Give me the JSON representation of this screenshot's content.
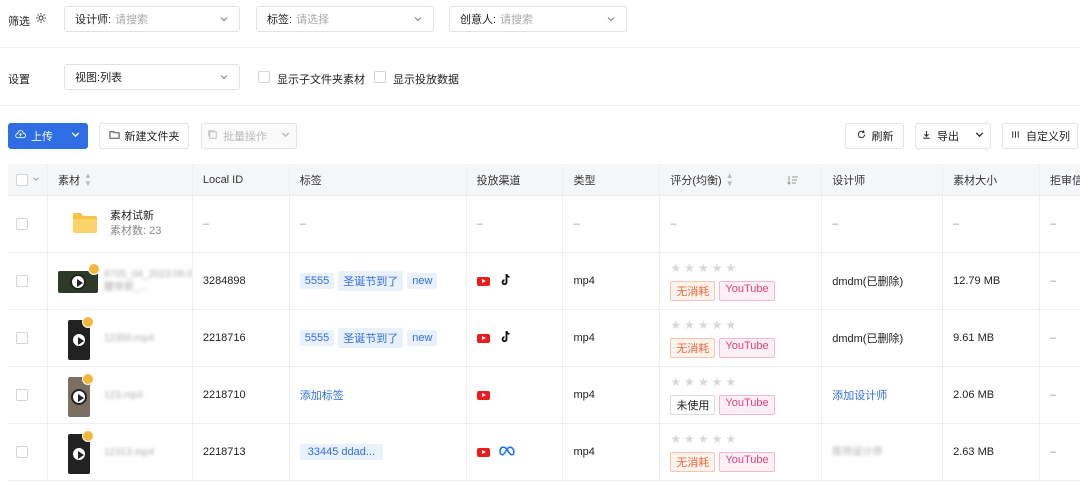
{
  "filter": {
    "label": "筛选",
    "designer": {
      "key": "设计师:",
      "placeholder": "请搜索"
    },
    "tags": {
      "key": "标签:",
      "placeholder": "请选择"
    },
    "creator": {
      "key": "创意人:",
      "placeholder": "请搜索"
    }
  },
  "settings": {
    "label": "设置",
    "view": {
      "key": "视图:",
      "value": "列表"
    },
    "show_subfolder": "显示子文件夹素材",
    "show_delivery": "显示投放数据"
  },
  "toolbar": {
    "upload": "上传",
    "new_folder": "新建文件夹",
    "batch": "批量操作",
    "refresh": "刷新",
    "export": "导出",
    "custom_columns": "自定义列"
  },
  "table": {
    "headers": [
      "素材",
      "Local ID",
      "标签",
      "投放渠道",
      "类型",
      "评分(均衡)",
      "设计师",
      "素材大小",
      "拒审信"
    ],
    "folder_row": {
      "name": "素材试新",
      "count": "素材数: 23",
      "dash": "–"
    },
    "rows": [
      {
        "filename": "8705_04_2023.06.02_腰背新_...",
        "local_id": "3284898",
        "tags": [
          "5555",
          "圣诞节到了",
          "new"
        ],
        "channels": [
          "youtube",
          "tiktok"
        ],
        "type": "mp4",
        "status": "无消耗",
        "channel_pill": "YouTube",
        "designer": "dmdm(已删除)",
        "size": "12.79 MB",
        "reject": "–"
      },
      {
        "filename": "12350.mp4",
        "local_id": "2218716",
        "tags": [
          "5555",
          "圣诞节到了",
          "new"
        ],
        "channels": [
          "youtube",
          "tiktok"
        ],
        "type": "mp4",
        "status": "无消耗",
        "channel_pill": "YouTube",
        "designer": "dmdm(已删除)",
        "size": "9.61 MB",
        "reject": "–"
      },
      {
        "filename": "123.mp4",
        "local_id": "2218710",
        "tag_link": "添加标签",
        "channels": [
          "youtube"
        ],
        "type": "mp4",
        "status": "未使用",
        "channel_pill": "YouTube",
        "designer_link": "添加设计师",
        "size": "2.06 MB",
        "reject": "–"
      },
      {
        "filename": "12313.mp4",
        "local_id": "2218713",
        "tags": [
          "33445 ddad..."
        ],
        "channels": [
          "youtube",
          "meta"
        ],
        "type": "mp4",
        "status": "无消耗",
        "channel_pill": "YouTube",
        "designer_blur": "陈师设计师",
        "size": "2.63 MB",
        "reject": "–"
      }
    ]
  },
  "colors": {
    "primary": "#2f6de5",
    "tag_bg": "#e9f1fd",
    "status_orange": "#f06a3b",
    "youtube_pill": "#e0417c",
    "folder": "#f6c343"
  }
}
